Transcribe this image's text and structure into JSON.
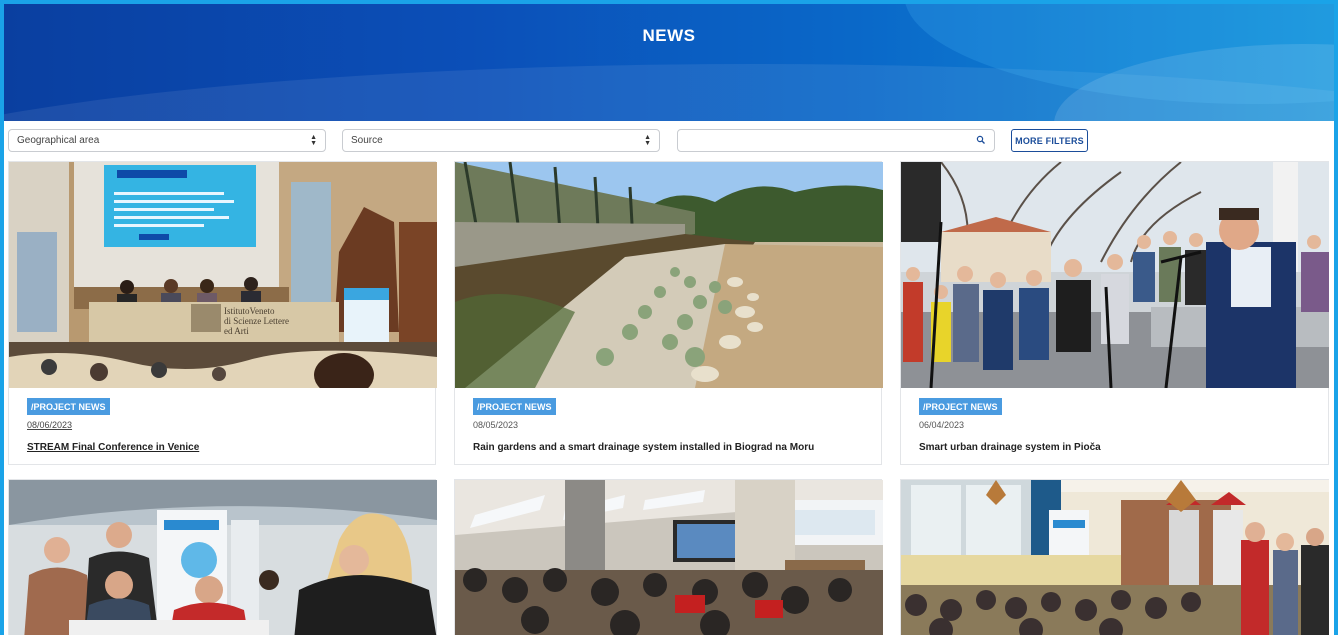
{
  "header": {
    "title": "NEWS"
  },
  "filters": {
    "geographical_area": "Geographical area",
    "source": "Source",
    "search_value": "",
    "more_filters": "MORE FILTERS"
  },
  "cards": [
    {
      "tag": "/PROJECT NEWS",
      "date": "08/06/2023",
      "title": "STREAM Final Conference in Venice"
    },
    {
      "tag": "/PROJECT NEWS",
      "date": "08/05/2023",
      "title": "Rain gardens and a smart drainage system installed in Biograd na Moru"
    },
    {
      "tag": "/PROJECT NEWS",
      "date": "06/04/2023",
      "title": "Smart urban drainage system in Pioča"
    }
  ],
  "photo_texts": {
    "venice_podium": "IstitutoVeneto di Scienze Lettere ed Arti"
  }
}
